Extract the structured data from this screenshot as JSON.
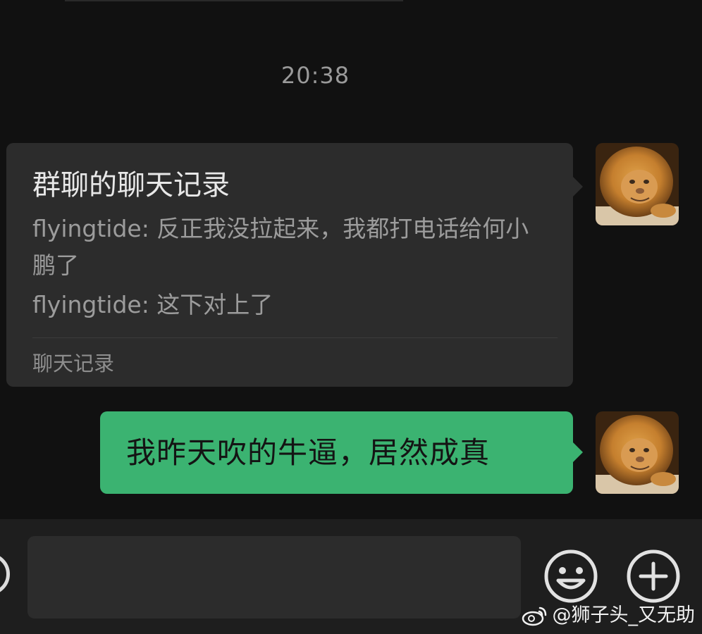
{
  "chat": {
    "timestamp": "20:38",
    "record_card": {
      "title": "群聊的聊天记录",
      "lines": [
        "flyingtide: 反正我没拉起来，我都打电话给何小鹏了",
        "flyingtide: 这下对上了"
      ],
      "footer": "聊天记录"
    },
    "message": {
      "text": "我昨天吹的牛逼，居然成真"
    }
  },
  "input_bar": {
    "voice_icon": "voice-icon",
    "emoji_icon": "emoji-icon",
    "plus_icon": "plus-icon",
    "input_value": ""
  },
  "watermark": {
    "text": "@狮子头_又无助",
    "logo": "weibo-logo"
  },
  "colors": {
    "background": "#111111",
    "bubble_dark": "#2c2c2c",
    "bubble_green": "#3bb371",
    "input_bar": "#1e1e1e"
  }
}
